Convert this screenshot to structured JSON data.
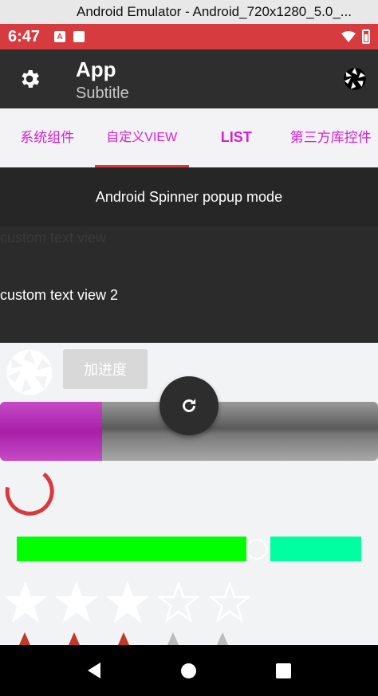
{
  "window": {
    "title": "Android Emulator - Android_720x1280_5.0_..."
  },
  "statusbar": {
    "time": "6:47",
    "left_icons": [
      "a-icon",
      "sd-card-icon"
    ],
    "right_icons": [
      "wifi-icon",
      "battery-icon"
    ]
  },
  "appbar": {
    "title": "App",
    "subtitle": "Subtitle",
    "left_icon": "gear-icon",
    "right_icon": "shutter-icon"
  },
  "tabs": [
    {
      "label": "系统组件",
      "active": false
    },
    {
      "label": "自定义VIEW",
      "active": true
    },
    {
      "label": "LIST",
      "active": false
    },
    {
      "label": "第三方库控件",
      "active": false
    }
  ],
  "spinner": {
    "label": "Android Spinner popup mode"
  },
  "custom_views": {
    "item1": "custom text view",
    "item2": "custom text view 2"
  },
  "progress_button": {
    "label": "加进度"
  },
  "big_progress": {
    "fraction": 0.27,
    "fill_color": "#b02eb0"
  },
  "fab": {
    "icon": "refresh-icon"
  },
  "seekbar": {
    "fraction": 0.6,
    "left_color": "#00ff00",
    "right_color": "#00ffa0"
  },
  "rating": {
    "value": 3,
    "max": 5
  },
  "small_rating": {
    "value": 3,
    "max": 5,
    "active_color": "#c0392b"
  },
  "colors": {
    "accent": "#d63b3f",
    "tab_text": "#d61fd6",
    "appbar": "#2e2e2e"
  }
}
